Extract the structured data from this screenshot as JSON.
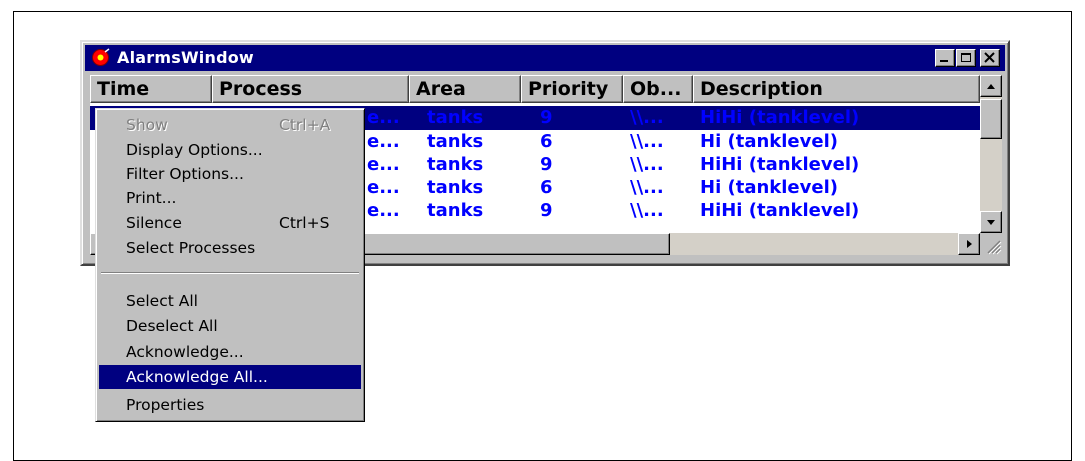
{
  "window": {
    "title": "AlarmsWindow",
    "controls": {
      "minimize_icon": "minimize-icon",
      "maximize_icon": "maximize-icon",
      "close_icon": "close-icon"
    }
  },
  "columns": [
    "Time",
    "Process",
    "Area",
    "Priority",
    "Ob...",
    "Description"
  ],
  "rows": [
    {
      "process": "e...",
      "area": "tanks",
      "priority": "9",
      "object": "\\\\...",
      "description": "HiHi (tanklevel)",
      "selected": true
    },
    {
      "process": "e...",
      "area": "tanks",
      "priority": "6",
      "object": "\\\\...",
      "description": "Hi (tanklevel)",
      "selected": false
    },
    {
      "process": "e...",
      "area": "tanks",
      "priority": "9",
      "object": "\\\\...",
      "description": "HiHi (tanklevel)",
      "selected": false
    },
    {
      "process": "e...",
      "area": "tanks",
      "priority": "6",
      "object": "\\\\...",
      "description": "Hi (tanklevel)",
      "selected": false
    },
    {
      "process": "e...",
      "area": "tanks",
      "priority": "9",
      "object": "\\\\...",
      "description": "HiHi (tanklevel)",
      "selected": false
    }
  ],
  "context_menu": {
    "items": [
      {
        "label": "Show",
        "shortcut": "Ctrl+A",
        "disabled": true
      },
      {
        "label": "Display Options...",
        "shortcut": ""
      },
      {
        "label": "Filter Options...",
        "shortcut": ""
      },
      {
        "label": "Print...",
        "shortcut": ""
      },
      {
        "label": "Silence",
        "shortcut": "Ctrl+S"
      },
      {
        "label": "Select Processes",
        "shortcut": ""
      },
      {
        "label": "Select All",
        "shortcut": ""
      },
      {
        "label": "Deselect All",
        "shortcut": ""
      },
      {
        "label": "Acknowledge...",
        "shortcut": ""
      },
      {
        "label": "Acknowledge All...",
        "shortcut": "",
        "highlighted": true
      },
      {
        "label": "Properties",
        "shortcut": ""
      }
    ]
  },
  "colors": {
    "titlebar": "#000080",
    "row_text": "#0000ff",
    "selection": "#000080",
    "face": "#c0c0c0"
  }
}
